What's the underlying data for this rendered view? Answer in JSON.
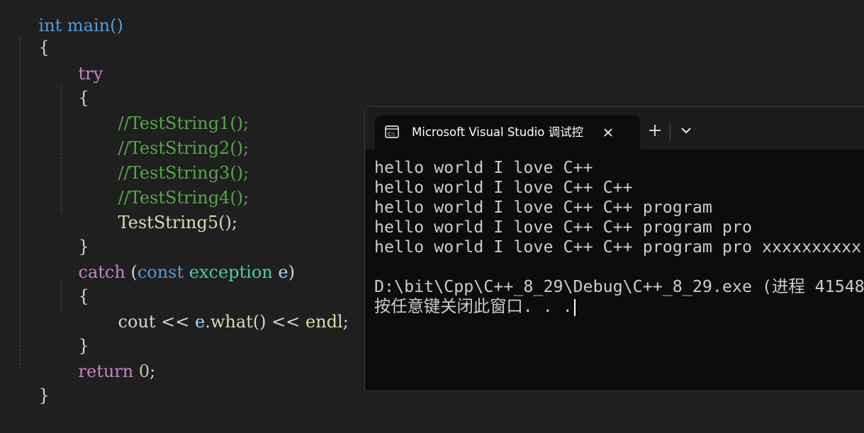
{
  "editor": {
    "line_main": "int main()",
    "open_brace": "{",
    "try_kw": "try",
    "try_open": "{",
    "comment1": "//TestString1();",
    "comment2": "//TestString2();",
    "comment3": "//TestString3();",
    "comment4": "//TestString4();",
    "call_fn": "TestString5",
    "call_tail": "();",
    "try_close": "}",
    "catch_kw": "catch",
    "catch_open_paren": " (",
    "catch_const": "const",
    "catch_type": "exception",
    "catch_var": "e",
    "catch_close_paren": ")",
    "catch_open": "{",
    "cout_name": "cout",
    "cout_op1": " << ",
    "cout_obj": "e",
    "cout_dot": ".",
    "cout_method": "what",
    "cout_parens": "()",
    "cout_op2": " << ",
    "cout_endl": "endl",
    "cout_semi": ";",
    "catch_close": "}",
    "return_kw": "return",
    "return_val": " 0",
    "return_semi": ";",
    "close_brace": "}"
  },
  "terminal": {
    "tab_title": "Microsoft Visual Studio 调试控",
    "tab_icon": "terminal-icon",
    "new_tab_icon": "plus-icon",
    "dropdown_icon": "chevron-down-icon",
    "lines": [
      "hello world I love C++",
      "hello world I love C++ C++",
      "hello world I love C++ C++ program",
      "hello world I love C++ C++ program pro",
      "hello world I love C++ C++ program pro xxxxxxxxxx",
      "",
      "D:\\bit\\Cpp\\C++_8_29\\Debug\\C++_8_29.exe (进程 41548",
      "按任意键关闭此窗口. . ."
    ]
  },
  "colors": {
    "editor_bg": "#1f1f1f",
    "terminal_bg": "#0c0c0c",
    "keyword": "#c586c0",
    "comment": "#57a64a",
    "function": "#dcdcaa",
    "type": "#4ec9b0"
  }
}
